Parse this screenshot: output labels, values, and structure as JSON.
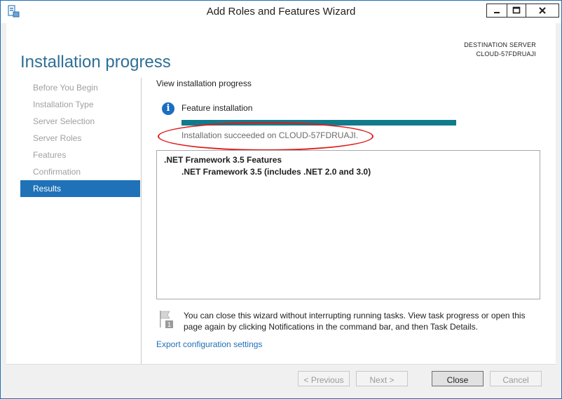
{
  "window": {
    "title": "Add Roles and Features Wizard",
    "icon": "server-manager-icon",
    "controls": [
      "minimize-icon",
      "maximize-icon",
      "close-icon"
    ]
  },
  "header": {
    "page_title": "Installation progress",
    "destination_label": "DESTINATION SERVER",
    "destination_server": "CLOUD-57FDRUAJI"
  },
  "steps": [
    {
      "label": "Before You Begin",
      "active": false
    },
    {
      "label": "Installation Type",
      "active": false
    },
    {
      "label": "Server Selection",
      "active": false
    },
    {
      "label": "Server Roles",
      "active": false
    },
    {
      "label": "Features",
      "active": false
    },
    {
      "label": "Confirmation",
      "active": false
    },
    {
      "label": "Results",
      "active": true
    }
  ],
  "main": {
    "view_label": "View installation progress",
    "feature_label": "Feature installation",
    "progress_percent": 100,
    "status_text": "Installation succeeded on CLOUD-57FDRUAJI.",
    "results": [
      ".NET Framework 3.5 Features",
      ".NET Framework 3.5 (includes .NET 2.0 and 3.0)"
    ],
    "note": "You can close this wizard without interrupting running tasks. View task progress or open this page again by clicking Notifications in the command bar, and then Task Details.",
    "export_link": "Export configuration settings"
  },
  "footer": {
    "previous": "< Previous",
    "next": "Next >",
    "close": "Close",
    "cancel": "Cancel"
  },
  "colors": {
    "accent": "#1f72b8",
    "title_blue": "#2e6f95",
    "progress": "#117b8c",
    "annotation_red": "#e01919"
  }
}
